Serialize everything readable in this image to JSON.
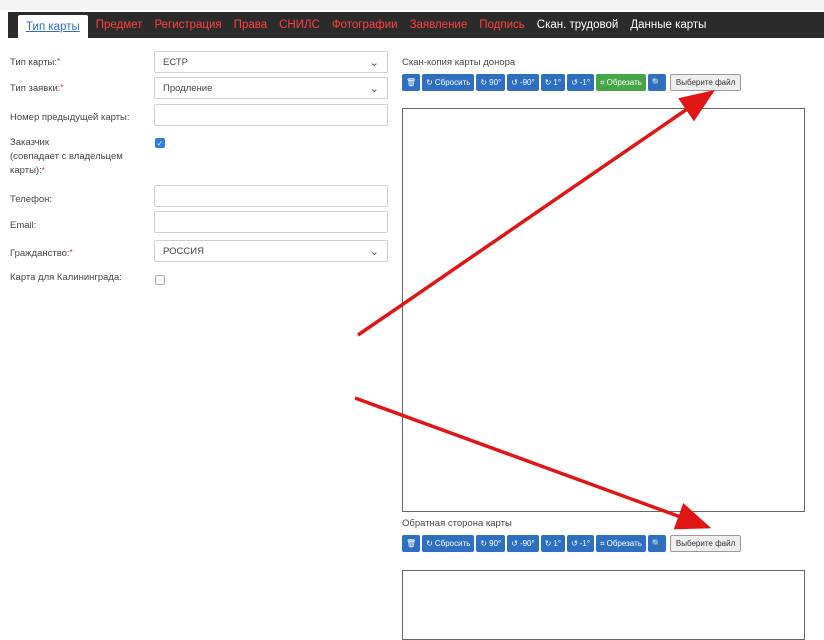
{
  "tabs": [
    {
      "label": "Тип карты"
    },
    {
      "label": "Предмет"
    },
    {
      "label": "Регистрация"
    },
    {
      "label": "Права"
    },
    {
      "label": "СНИЛС"
    },
    {
      "label": "Фотографии"
    },
    {
      "label": "Заявление"
    },
    {
      "label": "Подпись"
    },
    {
      "label": "Скан. трудовой"
    },
    {
      "label": "Данные карты"
    }
  ],
  "form": {
    "card_type": {
      "label": "Тип карты:",
      "value": "ЕСТР"
    },
    "request_type": {
      "label": "Тип заявки:",
      "value": "Продление"
    },
    "prev_number": {
      "label": "Номер предыдущей карты:",
      "value": ""
    },
    "applicant": {
      "label_line1": "Заказчик",
      "label_line2": "(совпадает с владельцем",
      "label_line3": "карты):",
      "checked": true
    },
    "phone": {
      "label": "Телефон:",
      "value": ""
    },
    "email": {
      "label": "Email:",
      "value": ""
    },
    "citizenship": {
      "label": "Гражданство:",
      "value": "РОССИЯ"
    },
    "kaliningrad": {
      "label": "Карта для Калининграда:",
      "checked": false
    }
  },
  "scan_front": {
    "label": "Скан-копия карты донора"
  },
  "scan_back": {
    "label": "Обратная сторона карты"
  },
  "toolbar": {
    "reset": "Сбросить",
    "rot90": "90°",
    "rotm90": "-90°",
    "rot1": "1°",
    "rotm1": "-1°",
    "crop": "Обрезать",
    "choose_file": "Выберите файл"
  },
  "colors": {
    "tab_bar": "#2b2b2b",
    "tab_text": "#ff4040",
    "button_blue": "#2e6fc2",
    "button_green": "#46a546",
    "arrow": "#e01515"
  }
}
